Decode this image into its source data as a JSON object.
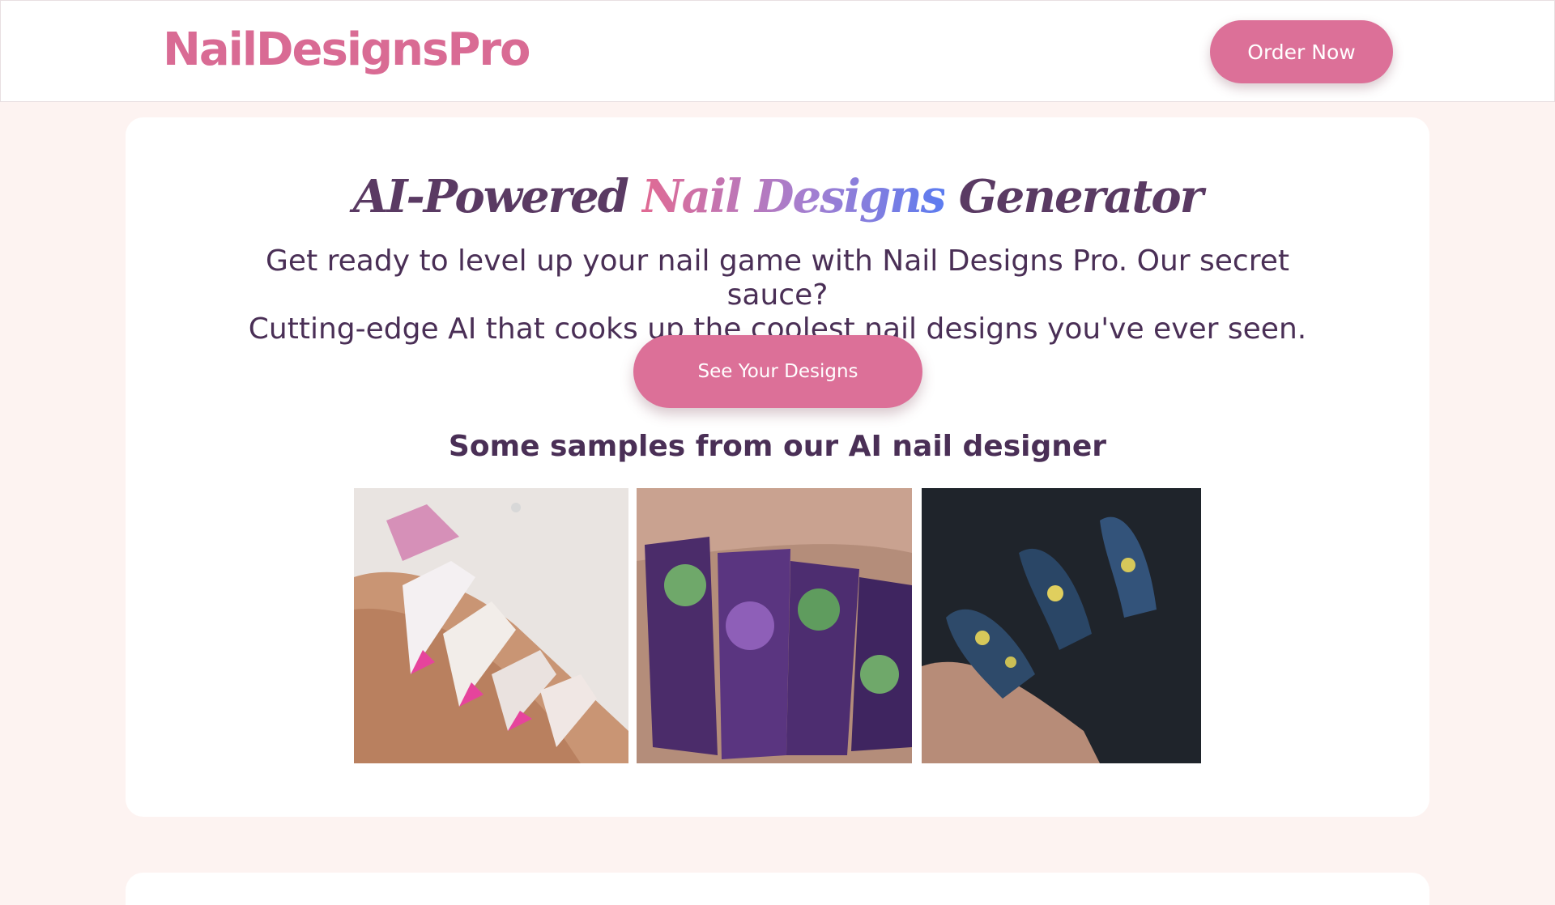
{
  "header": {
    "logo": "NailDesignsPro",
    "order_label": "Order Now"
  },
  "hero": {
    "title_before": "AI-Powered",
    "title_highlight": "Nail Designs",
    "title_after": "Generator",
    "description_line1": "Get ready to level up your nail game with Nail Designs Pro. Our secret sauce?",
    "description_line2": "Cutting-edge AI that cooks up the coolest nail designs you've ever seen.",
    "cta_label": "See Your Designs"
  },
  "samples": {
    "heading": "Some samples from our AI nail designer"
  },
  "colors": {
    "brand_pink": "#dc7098",
    "heading_purple": "#5a3a63",
    "page_background": "#fdf3f1"
  }
}
